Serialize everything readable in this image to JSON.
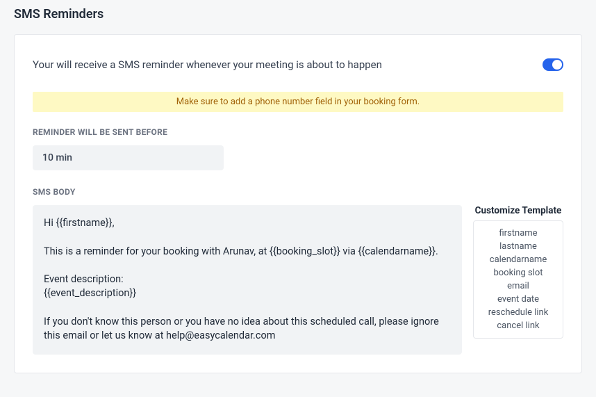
{
  "page_title": "SMS Reminders",
  "description": "Your will receive a SMS reminder whenever your meeting is about to happen",
  "toggle_on": true,
  "alert_text": "Make sure to add a phone number field in your booking form.",
  "reminder_label": "REMINDER WILL BE SENT BEFORE",
  "reminder_value": "10 min",
  "sms_body_label": "SMS BODY",
  "sms_body_text": "Hi {{firstname}},\n\nThis is a reminder for your booking with Arunav, at {{booking_slot}} via {{calendarname}}.\n\nEvent description:\n{{event_description}}\n\nIf you don't know this person or you have no idea about this scheduled call, please ignore this email or let us know at help@easycalendar.com",
  "template_title": "Customize Template",
  "tokens": {
    "t0": "firstname",
    "t1": "lastname",
    "t2": "calendarname",
    "t3": "booking slot",
    "t4": "email",
    "t5": "event date",
    "t6": "reschedule link",
    "t7": "cancel link"
  }
}
